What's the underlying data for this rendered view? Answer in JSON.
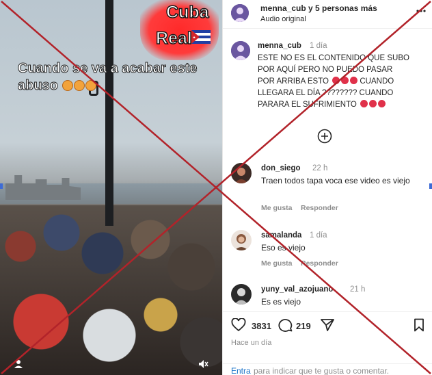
{
  "video": {
    "badge_line1": "Cuba",
    "badge_line2": "Real",
    "caption": "Cuando se va a acabar este abuso"
  },
  "header": {
    "username_line": "menna_cub y 5 personas más",
    "subtitle": "Audio original"
  },
  "caption": {
    "username": "menna_cub",
    "time": "1 día",
    "line1": "ESTE NO ES EL CONTENIDO QUE SUBO",
    "line2": "POR AQUÍ PERO NO PUEDO PASAR",
    "line3": "POR ARRIBA ESTO",
    "line3b": "CUANDO",
    "line4": "LLEGARA EL DÍA ???????? CUANDO",
    "line5": "PARARA EL SUFRIMIENTO"
  },
  "comments": [
    {
      "username": "don_siego",
      "time": "22 h",
      "text": "Traen todos tapa voca ese video es viejo",
      "like": "Me gusta",
      "reply": "Responder"
    },
    {
      "username": "samalanda",
      "time": "1 día",
      "text": "Eso es viejo",
      "like": "Me gusta",
      "reply": "Responder"
    },
    {
      "username": "yuny_val_azojuano",
      "time": "21 h",
      "text": "Es es viejo",
      "like": "",
      "reply": ""
    }
  ],
  "actions": {
    "likes": "3831",
    "comments": "219",
    "ago": "Hace un día"
  },
  "footer": {
    "link": "Entra",
    "rest": "para indicar que te gusta o comentar."
  },
  "colors": {
    "cross": "#b2232a",
    "badge": "#ff3030",
    "link": "#1a73c8"
  }
}
